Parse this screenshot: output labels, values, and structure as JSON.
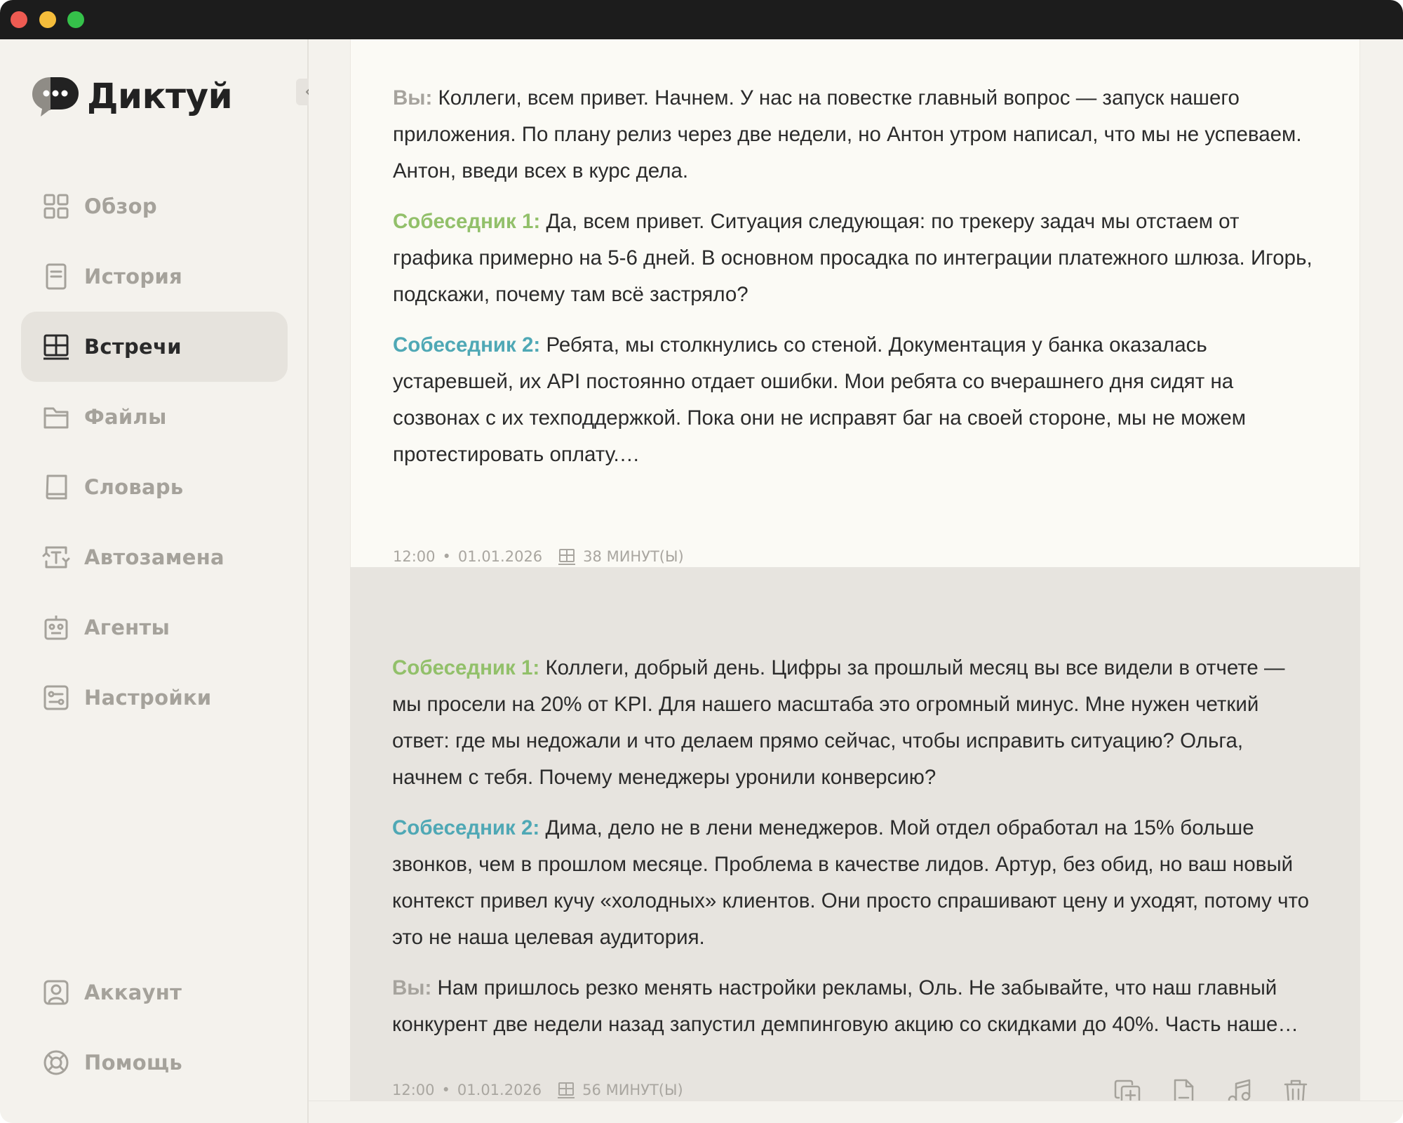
{
  "app": {
    "name": "Диктуй"
  },
  "sidebar": {
    "items": [
      {
        "label": "Обзор",
        "icon": "grid-icon"
      },
      {
        "label": "История",
        "icon": "document-icon"
      },
      {
        "label": "Встречи",
        "icon": "table-icon",
        "active": true
      },
      {
        "label": "Файлы",
        "icon": "folder-icon"
      },
      {
        "label": "Словарь",
        "icon": "book-icon"
      },
      {
        "label": "Автозамена",
        "icon": "text-replace-icon"
      },
      {
        "label": "Агенты",
        "icon": "robot-icon"
      },
      {
        "label": "Настройки",
        "icon": "sliders-icon"
      }
    ],
    "bottom_items": [
      {
        "label": "Аккаунт",
        "icon": "user-icon"
      },
      {
        "label": "Помощь",
        "icon": "lifebuoy-icon"
      }
    ]
  },
  "meetings": [
    {
      "lines": [
        {
          "speaker": "Вы:",
          "text": " Коллеги, всем привет. Начнем. У нас на повестке главный вопрос — запуск нашего приложения. По плану релиз через две недели, но Антон утром написал, что мы не успеваем. Антон, введи всех в курс дела."
        },
        {
          "speaker": "Собеседник 1:",
          "text": " Да, всем привет. Ситуация следующая: по трекеру задач мы отстаем от графика примерно на 5-6 дней. В основном просадка по интеграции платежного шлюза. Игорь, подскажи, почему там всё застряло?"
        },
        {
          "speaker": "Собеседник 2:",
          "text": " Ребята, мы столкнулись со стеной. Документация у банка оказалась устаревшей, их API постоянно отдает ошибки. Мои ребята со вчерашнего дня сидят на созвонах с их техподдержкой. Пока они не исправят баг на своей стороне, мы не можем протестировать оплату.…"
        }
      ],
      "time": "12:00",
      "date": "01.01.2026",
      "duration": "38 МИНУТ(Ы)"
    },
    {
      "lines": [
        {
          "speaker": "Собеседник 1:",
          "text": " Коллеги, добрый день. Цифры за прошлый месяц вы все видели в отчете — мы просели на 20% от KPI. Для нашего масштаба это огромный минус. Мне нужен четкий ответ: где мы недожали и что делаем прямо сейчас, чтобы исправить ситуацию? Ольга, начнем с тебя. Почему менеджеры уронили конверсию?"
        },
        {
          "speaker": "Собеседник 2:",
          "text": " Дима, дело не в лени менеджеров. Мой отдел обработал на 15% больше звонков, чем в прошлом месяце. Проблема в качестве лидов. Артур, без обид, но ваш новый контекст привел кучу «холодных» клиентов. Они просто спрашивают цену и уходят, потому что это не наша целевая аудитория."
        },
        {
          "speaker": "Вы:",
          "text": " Нам пришлось резко менять настройки рекламы, Оль. Не забывайте, что наш главный конкурент две недели назад запустил демпинговую акцию со скидками до 40%. Часть наше…"
        }
      ],
      "time": "12:00",
      "date": "01.01.2026",
      "duration": "56 МИНУТ(Ы)"
    }
  ]
}
